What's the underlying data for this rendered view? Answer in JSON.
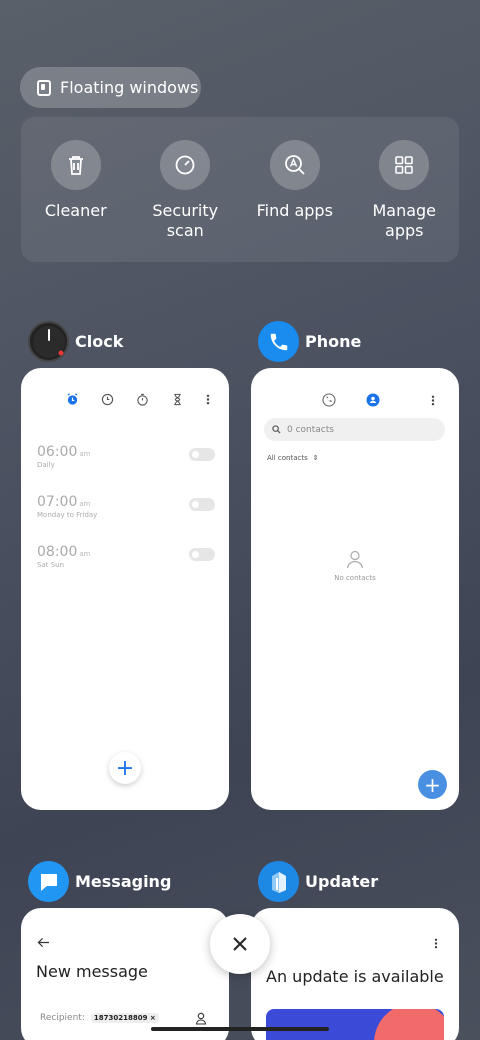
{
  "floating_windows": {
    "label": "Floating windows",
    "icon": "window-icon"
  },
  "tools": [
    {
      "label": "Cleaner",
      "icon": "trash-icon"
    },
    {
      "label": "Security scan",
      "icon": "scan-icon"
    },
    {
      "label": "Find apps",
      "icon": "find-apps-icon"
    },
    {
      "label": "Manage apps",
      "icon": "grid-icon"
    }
  ],
  "apps": {
    "clock": {
      "name": "Clock",
      "alarms": [
        {
          "time": "06:00",
          "ampm": "am",
          "repeat": "Daily"
        },
        {
          "time": "07:00",
          "ampm": "am",
          "repeat": "Monday to Friday"
        },
        {
          "time": "08:00",
          "ampm": "am",
          "repeat": "Sat Sun"
        }
      ]
    },
    "phone": {
      "name": "Phone",
      "search_placeholder": "0 contacts",
      "filter": "All contacts",
      "empty_text": "No contacts"
    },
    "messaging": {
      "name": "Messaging",
      "title": "New message",
      "recipient_label": "Recipient:",
      "recipient_chip": "18730218809"
    },
    "updater": {
      "name": "Updater",
      "title": "An update is available"
    }
  },
  "colors": {
    "accent": "#1a73e8",
    "phone_blue": "#1a8cf0",
    "fab_blue": "#4a90e2"
  }
}
